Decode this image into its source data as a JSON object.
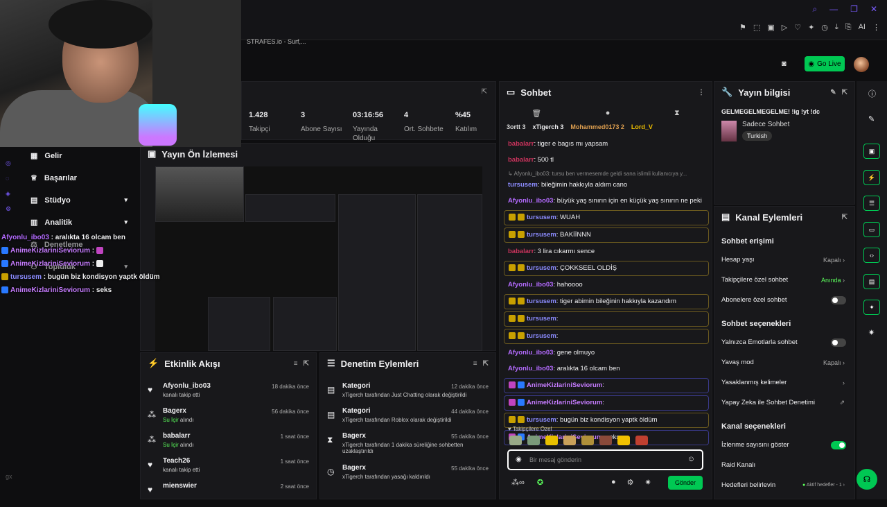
{
  "browser": {
    "tab_title": "STRAFES.io - Surf,...",
    "ai_label": "AI"
  },
  "header": {
    "go_live": "Go Live"
  },
  "stats": [
    {
      "value": "1.428",
      "label": "Takipçi"
    },
    {
      "value": "3",
      "label": "Abone Sayısı"
    },
    {
      "value": "03:16:56",
      "label": "Yayında Olduğu"
    },
    {
      "value": "4",
      "label": "Ort. Sohbete"
    },
    {
      "value": "%45",
      "label": "Katılım"
    }
  ],
  "nav": {
    "items": [
      "Gelir",
      "Başarılar",
      "Stüdyo",
      "Analitik",
      "Denetleme",
      "Topluluk"
    ]
  },
  "preview": {
    "title": "Yayın Ön İzlemesi"
  },
  "overlay_chat": [
    {
      "user": "Afyonlu_ibo03",
      "text": " : aralıkta 16 olcam ben",
      "cls": "u1"
    },
    {
      "user": "AnimeKizlariniSeviorum",
      "text": " : ",
      "cls": "u4"
    },
    {
      "user": "AnimeKizlariniSeviorum",
      "text": " : ",
      "cls": "u4"
    },
    {
      "user": "tursusem",
      "text": " : bugün biz kondisyon yaptk öldüm",
      "cls": "u2"
    },
    {
      "user": "AnimeKizlariniSeviorum",
      "text": " : seks",
      "cls": "u4"
    }
  ],
  "activity": {
    "title": "Etkinlik Akışı",
    "rows": [
      {
        "name": "Afyonlu_ibo03",
        "time": "18 dakika önce",
        "sub": "kanalı takip etti",
        "icon": "♥"
      },
      {
        "name": "Bagerx",
        "time": "56 dakika önce",
        "sub": "Su İçir",
        "sub2": " alındı",
        "icon": "⁂"
      },
      {
        "name": "babalarr",
        "time": "1 saat önce",
        "sub": "Su İçir",
        "sub2": " alındı",
        "icon": "⁂"
      },
      {
        "name": "Teach26",
        "time": "1 saat önce",
        "sub": "kanalı takip etti",
        "icon": "♥"
      },
      {
        "name": "mienswier",
        "time": "2 saat önce",
        "sub": "",
        "icon": "♥"
      }
    ]
  },
  "moderation": {
    "title": "Denetim Eylemleri",
    "rows": [
      {
        "name": "Kategori",
        "time": "12 dakika önce",
        "sub": "xTigerch tarafından Just Chatting olarak değiştirildi"
      },
      {
        "name": "Kategori",
        "time": "44 dakika önce",
        "sub": "xTigerch tarafından Roblox olarak değiştirildi"
      },
      {
        "name": "Bagerx",
        "time": "55 dakika önce",
        "sub": "xTigerch tarafından 1 dakika süreliğine sohbetten uzaklaştırıldı"
      },
      {
        "name": "Bagerx",
        "time": "55 dakika önce",
        "sub": "xTigerch tarafından yasağı kaldırıldı"
      }
    ]
  },
  "chat": {
    "title": "Sohbet",
    "leaders": [
      "3ortt 3",
      "xTigerch 3",
      "Mohammed0173 2",
      "Lord_V"
    ],
    "messages": [
      {
        "user": "babalarr",
        "text": ": tiger e bagıs mı yapsam",
        "cls": "u3",
        "style": ""
      },
      {
        "user": "babalarr",
        "text": ": 500 tl",
        "cls": "u3",
        "style": ""
      },
      {
        "user": "tursusem",
        "text": ": bileğimin hakkıyla aldım cano",
        "cls": "u2",
        "style": "",
        "reply": "↳ Afyonlu_ibo03: tursu ben vermesemde geldi sana islimli kullanıcıya y..."
      },
      {
        "user": "Afyonlu_ibo03",
        "text": ": büyük yaş sınırın için en küçük yaş sınırın ne peki",
        "cls": "u1",
        "style": ""
      },
      {
        "user": "tursusem",
        "text": ": WUAH",
        "cls": "u2",
        "style": "hl"
      },
      {
        "user": "tursusem",
        "text": ": BAKİİNNN",
        "cls": "u2",
        "style": "hl"
      },
      {
        "user": "babalarr",
        "text": ": 3 lira cıkarmı sence",
        "cls": "u3",
        "style": ""
      },
      {
        "user": "tursusem",
        "text": ": ÇOKKSEEL OLDİŞ",
        "cls": "u2",
        "style": "hl"
      },
      {
        "user": "Afyonlu_ibo03",
        "text": ": hahoooo",
        "cls": "u1",
        "style": ""
      },
      {
        "user": "tursusem",
        "text": ": tiger abimin bileğinin hakkıyla kazandım",
        "cls": "u2",
        "style": "hl"
      },
      {
        "user": "tursusem",
        "text": ":",
        "cls": "u2",
        "style": "hl"
      },
      {
        "user": "tursusem",
        "text": ":",
        "cls": "u2",
        "style": "hl"
      },
      {
        "user": "Afyonlu_ibo03",
        "text": ": gene olmuyo",
        "cls": "u1",
        "style": ""
      },
      {
        "user": "Afyonlu_ibo03",
        "text": ": aralıkta 16 olcam ben",
        "cls": "u1",
        "style": ""
      },
      {
        "user": "AnimeKizlariniSeviorum",
        "text": ":",
        "cls": "u4",
        "style": "hl2"
      },
      {
        "user": "AnimeKizlariniSeviorum",
        "text": ":",
        "cls": "u4",
        "style": "hl2"
      },
      {
        "user": "tursusem",
        "text": ": bugün biz kondisyon yaptk öldüm",
        "cls": "u2",
        "style": "hl"
      },
      {
        "user": "AnimeKizlariniSeviorum",
        "text": ": seks",
        "cls": "u4",
        "style": "hl2"
      }
    ],
    "followers_only": "Takipçilere Özel",
    "placeholder": "Bir mesaj gönderin",
    "send": "Gönder"
  },
  "info": {
    "title": "Yayın bilgisi",
    "stream_title": "GELMEGELMEGELME! !ig !yt !dc",
    "category": "Sadece Sohbet",
    "tag": "Turkish"
  },
  "actions": {
    "title": "Kanal Eylemleri",
    "s1": "Sohbet erişimi",
    "r1": "Hesap yaşı",
    "r1v": "Kapalı",
    "r2": "Takipçilere özel sohbet",
    "r2v": "Anında",
    "r3": "Abonelere özel sohbet",
    "s2": "Sohbet seçenekleri",
    "r4": "Yalnızca Emotlarla sohbet",
    "r5": "Yavaş mod",
    "r5v": "Kapalı",
    "r6": "Yasaklanmış kelimeler",
    "r7": "Yapay Zeka ile Sohbet Denetimi",
    "s3": "Kanal seçenekleri",
    "r8": "İzlenme sayısını göster",
    "r9": "Raid Kanalı",
    "r10": "Hedefleri belirlevin",
    "r10v": "Aktif hedefler - 1"
  },
  "colors": {
    "accent": "#00c853",
    "brand": "#7a5cff"
  }
}
